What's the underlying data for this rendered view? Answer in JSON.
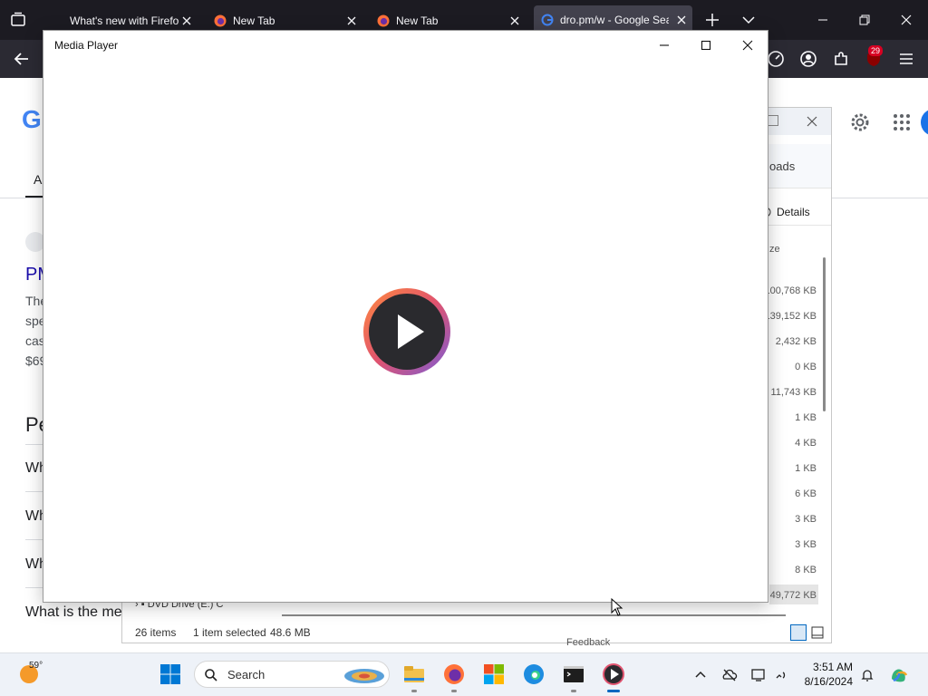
{
  "browser": {
    "tabs": [
      {
        "title": "What's new with Firefox"
      },
      {
        "title": "New Tab"
      },
      {
        "title": "New Tab"
      },
      {
        "title": "dro.pm/w - Google Search"
      }
    ],
    "extensions_badge": "29"
  },
  "google": {
    "logo": "G",
    "tab_partial": "A",
    "result_title_partial": "PM",
    "snippet_lines": [
      "The",
      "spe",
      "cas",
      "$69"
    ],
    "section_heading_partial": "Pe",
    "questions": [
      "Wh",
      "Wh",
      "Wh",
      "What is the me"
    ]
  },
  "explorer": {
    "tab_partial": "oads",
    "details_label": "Details",
    "column_header_partial": "ze",
    "sizes": [
      "100,768 KB",
      "139,152 KB",
      "2,432 KB",
      "0 KB",
      "11,743 KB",
      "1 KB",
      "4 KB",
      "1 KB",
      "6 KB",
      "3 KB",
      "3 KB",
      "8 KB",
      "49,772 KB"
    ],
    "tree_item": "DVD Drive (E:) C",
    "status": {
      "items": "26 items",
      "selected": "1 item selected",
      "size": "48.6 MB"
    },
    "footer_partial": "Feedback"
  },
  "media_player": {
    "title": "Media Player"
  },
  "taskbar": {
    "temperature": "59°",
    "search_label": "Search",
    "time": "3:51 AM",
    "date": "8/16/2024"
  },
  "colors": {
    "firefox_dark": "#1c1b22",
    "accent": "#0067c0"
  }
}
